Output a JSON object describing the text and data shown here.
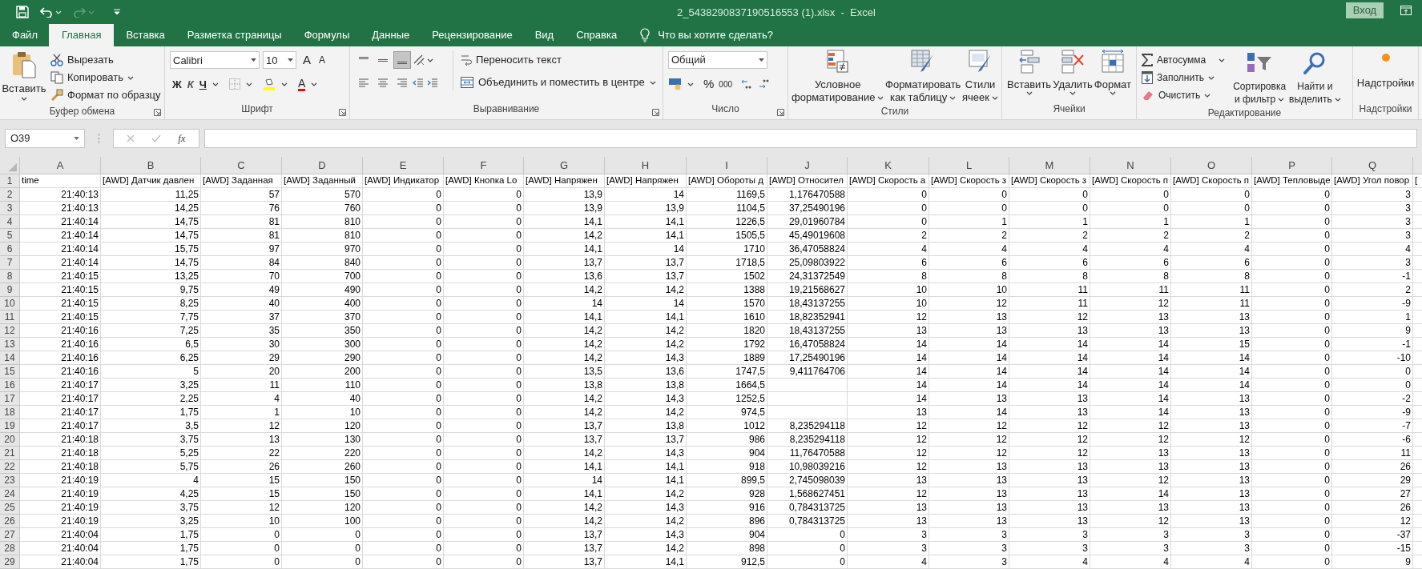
{
  "title_bar": {
    "title": "2_5438290837190516553 (1).xlsx  -  Excel",
    "sign_in": "Вход"
  },
  "tabs": [
    {
      "label": "Файл",
      "selected": false
    },
    {
      "label": "Главная",
      "selected": true
    },
    {
      "label": "Вставка",
      "selected": false
    },
    {
      "label": "Разметка страницы",
      "selected": false
    },
    {
      "label": "Формулы",
      "selected": false
    },
    {
      "label": "Данные",
      "selected": false
    },
    {
      "label": "Рецензирование",
      "selected": false
    },
    {
      "label": "Вид",
      "selected": false
    },
    {
      "label": "Справка",
      "selected": false
    }
  ],
  "tell_me": "Что вы хотите сделать?",
  "ribbon": [
    {
      "kind": "clipboard",
      "label": "Буфер обмена",
      "paste": "Вставить",
      "cut": "Вырезать",
      "copy": "Копировать",
      "format_painter": "Формат по образцу"
    },
    {
      "kind": "font",
      "label": "Шрифт",
      "font_name": "Calibri",
      "font_size": "10",
      "grow": "A",
      "shrink": "A",
      "bold": "Ж",
      "italic": "К",
      "underline": "Ч",
      "font_color": "A"
    },
    {
      "kind": "alignment",
      "label": "Выравнивание",
      "vertical": [
        {
          "selected": false
        },
        {
          "selected": false
        },
        {
          "selected": true
        }
      ],
      "wrap": "Переносить текст",
      "merge": "Объединить и поместить в центре"
    },
    {
      "kind": "number",
      "label": "Число",
      "format": "Общий",
      "percent": "%",
      "thousands": "000"
    },
    {
      "kind": "styles",
      "label": "Стили",
      "buttons": [
        {
          "lines": [
            "Условное",
            "форматирование"
          ]
        },
        {
          "lines": [
            "Форматировать",
            "как таблицу"
          ]
        },
        {
          "lines": [
            "Стили",
            "ячеек"
          ]
        }
      ]
    },
    {
      "kind": "cells",
      "label": "Ячейки",
      "buttons": [
        "Вставить",
        "Удалить",
        "Формат"
      ]
    },
    {
      "kind": "editing",
      "label": "Редактирование",
      "autosum": "Автосумма",
      "fill": "Заполнить",
      "clear": "Очистить",
      "sort": [
        "Сортировка",
        "и фильтр"
      ],
      "find": [
        "Найти и",
        "выделить"
      ]
    },
    {
      "kind": "addins",
      "label": "Надстройки",
      "button": "Надстройки"
    }
  ],
  "formula_bar": {
    "name_box": "O39",
    "fx": "fx"
  },
  "sheet": {
    "columns": [
      "A",
      "B",
      "C",
      "D",
      "E",
      "F",
      "G",
      "H",
      "I",
      "J",
      "K",
      "L",
      "M",
      "N",
      "O",
      "P",
      "Q"
    ],
    "header_row": {
      "number": "1",
      "cells": [
        "time",
        "[AWD] Датчик давлен",
        "[AWD] Заданная",
        "[AWD] Заданный",
        "[AWD] Индикатор",
        "[AWD] Кнопка Lo",
        "[AWD] Напряжен",
        "[AWD] Напряжен",
        "[AWD] Обороты д",
        "[AWD] Относител",
        "[AWD] Скорость а",
        "[AWD] Скорость з",
        "[AWD] Скорость з",
        "[AWD] Скорость п",
        "[AWD] Скорость п",
        "[AWD] Тепловыде",
        "[AWD] Угол повор",
        "["
      ]
    },
    "rows": [
      {
        "number": "2",
        "cells": [
          "21:40:13",
          "11,25",
          "57",
          "570",
          "0",
          "0",
          "13,9",
          "14",
          "1169,5",
          "1,176470588",
          "0",
          "0",
          "0",
          "0",
          "0",
          "0",
          "3"
        ]
      },
      {
        "number": "3",
        "cells": [
          "21:40:13",
          "14,25",
          "76",
          "760",
          "0",
          "0",
          "13,9",
          "13,9",
          "1104,5",
          "37,25490196",
          "0",
          "0",
          "0",
          "0",
          "0",
          "0",
          "3"
        ]
      },
      {
        "number": "4",
        "cells": [
          "21:40:14",
          "14,75",
          "81",
          "810",
          "0",
          "0",
          "14,1",
          "14,1",
          "1226,5",
          "29,01960784",
          "0",
          "1",
          "1",
          "1",
          "1",
          "0",
          "3"
        ]
      },
      {
        "number": "5",
        "cells": [
          "21:40:14",
          "14,75",
          "81",
          "810",
          "0",
          "0",
          "14,2",
          "14,1",
          "1505,5",
          "45,49019608",
          "2",
          "2",
          "2",
          "2",
          "2",
          "0",
          "3"
        ]
      },
      {
        "number": "6",
        "cells": [
          "21:40:14",
          "15,75",
          "97",
          "970",
          "0",
          "0",
          "14,1",
          "14",
          "1710",
          "36,47058824",
          "4",
          "4",
          "4",
          "4",
          "4",
          "0",
          "4"
        ]
      },
      {
        "number": "7",
        "cells": [
          "21:40:14",
          "14,75",
          "84",
          "840",
          "0",
          "0",
          "13,7",
          "13,7",
          "1718,5",
          "25,09803922",
          "6",
          "6",
          "6",
          "6",
          "6",
          "0",
          "3"
        ]
      },
      {
        "number": "8",
        "cells": [
          "21:40:15",
          "13,25",
          "70",
          "700",
          "0",
          "0",
          "13,6",
          "13,7",
          "1502",
          "24,31372549",
          "8",
          "8",
          "8",
          "8",
          "8",
          "0",
          "-1"
        ]
      },
      {
        "number": "9",
        "cells": [
          "21:40:15",
          "9,75",
          "49",
          "490",
          "0",
          "0",
          "14,2",
          "14,2",
          "1388",
          "19,21568627",
          "10",
          "10",
          "11",
          "11",
          "11",
          "0",
          "2"
        ]
      },
      {
        "number": "10",
        "cells": [
          "21:40:15",
          "8,25",
          "40",
          "400",
          "0",
          "0",
          "14",
          "14",
          "1570",
          "18,43137255",
          "10",
          "12",
          "11",
          "12",
          "11",
          "0",
          "-9"
        ]
      },
      {
        "number": "11",
        "cells": [
          "21:40:15",
          "7,75",
          "37",
          "370",
          "0",
          "0",
          "14,1",
          "14,1",
          "1610",
          "18,82352941",
          "12",
          "13",
          "12",
          "13",
          "13",
          "0",
          "1"
        ]
      },
      {
        "number": "12",
        "cells": [
          "21:40:16",
          "7,25",
          "35",
          "350",
          "0",
          "0",
          "14,2",
          "14,2",
          "1820",
          "18,43137255",
          "13",
          "13",
          "13",
          "13",
          "13",
          "0",
          "9"
        ]
      },
      {
        "number": "13",
        "cells": [
          "21:40:16",
          "6,5",
          "30",
          "300",
          "0",
          "0",
          "14,2",
          "14,2",
          "1792",
          "16,47058824",
          "14",
          "14",
          "14",
          "14",
          "15",
          "0",
          "-1"
        ]
      },
      {
        "number": "14",
        "cells": [
          "21:40:16",
          "6,25",
          "29",
          "290",
          "0",
          "0",
          "14,2",
          "14,3",
          "1889",
          "17,25490196",
          "14",
          "14",
          "14",
          "14",
          "14",
          "0",
          "-10"
        ]
      },
      {
        "number": "15",
        "cells": [
          "21:40:16",
          "5",
          "20",
          "200",
          "0",
          "0",
          "13,5",
          "13,6",
          "1747,5",
          "9,411764706",
          "14",
          "14",
          "14",
          "14",
          "14",
          "0",
          "0"
        ]
      },
      {
        "number": "16",
        "cells": [
          "21:40:17",
          "3,25",
          "11",
          "110",
          "0",
          "0",
          "13,8",
          "13,8",
          "1664,5",
          null,
          "14",
          "14",
          "14",
          "14",
          "14",
          "0",
          "0"
        ]
      },
      {
        "number": "17",
        "cells": [
          "21:40:17",
          "2,25",
          "4",
          "40",
          "0",
          "0",
          "14,2",
          "14,3",
          "1252,5",
          null,
          "14",
          "13",
          "13",
          "14",
          "13",
          "0",
          "-2"
        ]
      },
      {
        "number": "18",
        "cells": [
          "21:40:17",
          "1,75",
          "1",
          "10",
          "0",
          "0",
          "14,2",
          "14,2",
          "974,5",
          null,
          "13",
          "14",
          "13",
          "14",
          "13",
          "0",
          "-9"
        ]
      },
      {
        "number": "19",
        "cells": [
          "21:40:17",
          "3,5",
          "12",
          "120",
          "0",
          "0",
          "13,7",
          "13,8",
          "1012",
          "8,235294118",
          "12",
          "12",
          "12",
          "12",
          "13",
          "0",
          "-7"
        ]
      },
      {
        "number": "20",
        "cells": [
          "21:40:18",
          "3,75",
          "13",
          "130",
          "0",
          "0",
          "13,7",
          "13,7",
          "986",
          "8,235294118",
          "12",
          "12",
          "12",
          "12",
          "12",
          "0",
          "-6"
        ]
      },
      {
        "number": "21",
        "cells": [
          "21:40:18",
          "5,25",
          "22",
          "220",
          "0",
          "0",
          "14,2",
          "14,3",
          "904",
          "11,76470588",
          "12",
          "12",
          "12",
          "13",
          "13",
          "0",
          "11"
        ]
      },
      {
        "number": "22",
        "cells": [
          "21:40:18",
          "5,75",
          "26",
          "260",
          "0",
          "0",
          "14,1",
          "14,1",
          "918",
          "10,98039216",
          "12",
          "13",
          "13",
          "13",
          "13",
          "0",
          "26"
        ]
      },
      {
        "number": "23",
        "cells": [
          "21:40:19",
          "4",
          "15",
          "150",
          "0",
          "0",
          "14",
          "14,1",
          "899,5",
          "2,745098039",
          "13",
          "13",
          "13",
          "12",
          "13",
          "0",
          "29"
        ]
      },
      {
        "number": "24",
        "cells": [
          "21:40:19",
          "4,25",
          "15",
          "150",
          "0",
          "0",
          "14,1",
          "14,2",
          "928",
          "1,568627451",
          "12",
          "13",
          "13",
          "14",
          "13",
          "0",
          "27"
        ]
      },
      {
        "number": "25",
        "cells": [
          "21:40:19",
          "3,75",
          "12",
          "120",
          "0",
          "0",
          "14,2",
          "14,3",
          "916",
          "0,784313725",
          "13",
          "13",
          "13",
          "13",
          "13",
          "0",
          "26"
        ]
      },
      {
        "number": "26",
        "cells": [
          "21:40:19",
          "3,25",
          "10",
          "100",
          "0",
          "0",
          "14,2",
          "14,2",
          "896",
          "0,784313725",
          "13",
          "13",
          "13",
          "12",
          "13",
          "0",
          "12"
        ]
      },
      {
        "number": "27",
        "cells": [
          "21:40:04",
          "1,75",
          "0",
          "0",
          "0",
          "0",
          "13,7",
          "14,3",
          "904",
          "0",
          "3",
          "3",
          "3",
          "3",
          "3",
          "0",
          "-37"
        ]
      },
      {
        "number": "28",
        "cells": [
          "21:40:04",
          "1,75",
          "0",
          "0",
          "0",
          "0",
          "13,7",
          "14,2",
          "898",
          "0",
          "3",
          "3",
          "3",
          "3",
          "3",
          "0",
          "-15"
        ]
      },
      {
        "number": "29",
        "cells": [
          "21:40:04",
          "1,75",
          "0",
          "0",
          "0",
          "0",
          "13,7",
          "14,1",
          "912,5",
          "0",
          "4",
          "3",
          "4",
          "4",
          "4",
          "0",
          "9"
        ]
      }
    ]
  }
}
